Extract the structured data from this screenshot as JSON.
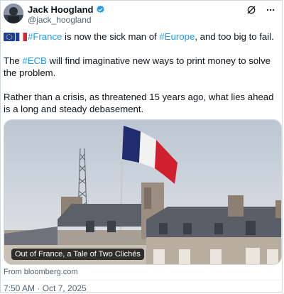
{
  "author": {
    "name": "Jack Hoogland",
    "handle": "@jack_hoogland",
    "verified": true
  },
  "icons": [
    "verified-badge-icon",
    "grok-icon",
    "more-icon",
    "eu-flag-icon",
    "france-flag-icon"
  ],
  "colors": {
    "link": "#1d9bf0",
    "secondary": "#536471",
    "verified": "#1d9bf0"
  },
  "post": {
    "p1_tag1": "#France",
    "p1_mid": " is now the sick man of ",
    "p1_tag2": "#Europe",
    "p1_end": ", and too big to fail.",
    "p2_start": "The ",
    "p2_tag": "#ECB",
    "p2_end": " will find imaginative new ways to print money to solve the problem.",
    "p3": "Rather than a crisis, as threatened 15 years ago, what lies ahead is a long and steady debasement."
  },
  "media": {
    "caption": "Out of France, a Tale of Two Clichés",
    "source": "From bloomberg.com"
  },
  "timestamp": "7:50 AM · Oct 7, 2025"
}
